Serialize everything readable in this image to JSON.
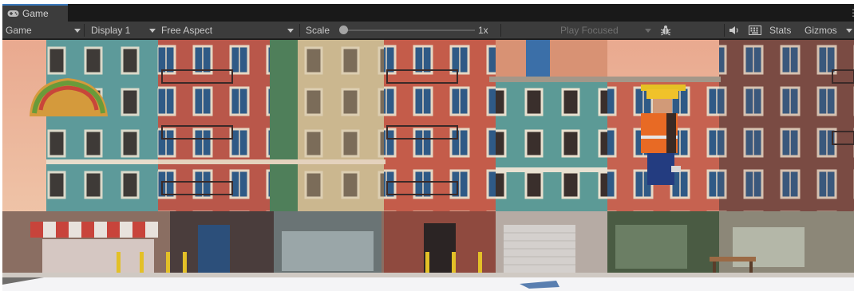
{
  "tab": {
    "label": "Game",
    "icon": "gamepad-icon"
  },
  "toolbar": {
    "display_mode": "Game",
    "display": "Display 1",
    "aspect": "Free Aspect",
    "scale_label": "Scale",
    "scale_value": "1x",
    "scale_fraction": 0,
    "play_mode": "Play Focused",
    "bug_icon": "bug-icon",
    "audio_icon": "speaker-icon",
    "stats_icon": "keyboard-icon",
    "stats_label": "Stats",
    "gizmos_label": "Gizmos"
  },
  "colors": {
    "accent_tab": "#3a79bb",
    "toolbar_bg": "#3c3c3c",
    "panel_bg": "#191919"
  },
  "scene": {
    "description_icons": [
      "taco-sign-icon",
      "character-icon",
      "building-facade-icon"
    ]
  }
}
